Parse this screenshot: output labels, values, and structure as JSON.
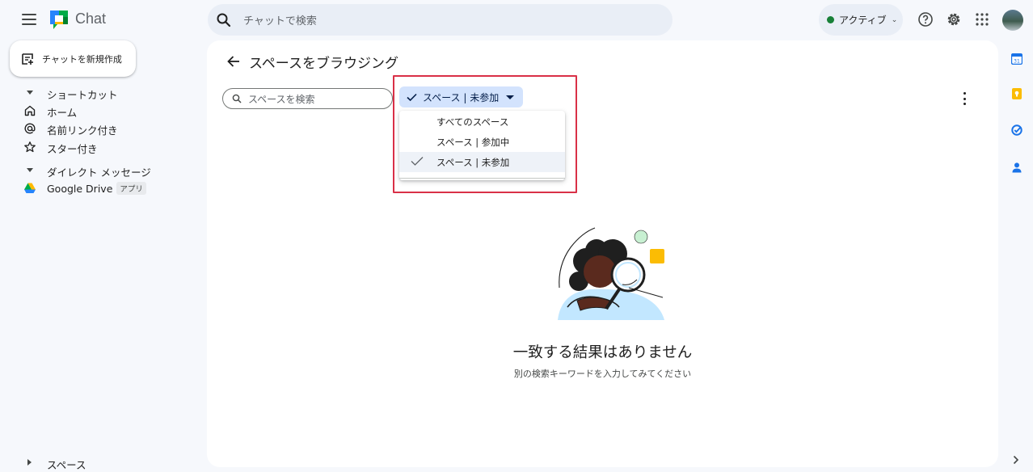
{
  "app": {
    "name": "Chat"
  },
  "header": {
    "search_placeholder": "チャットで検索",
    "status_label": "アクティブ",
    "status_color": "#188038"
  },
  "sidebar": {
    "new_chat_label": "チャットを新規作成",
    "shortcuts_label": "ショートカット",
    "items": [
      {
        "label": "ホーム",
        "icon": "home-icon"
      },
      {
        "label": "名前リンク付き",
        "icon": "at-icon"
      },
      {
        "label": "スター付き",
        "icon": "star-icon"
      }
    ],
    "dm_label": "ダイレクト メッセージ",
    "dm_items": [
      {
        "label": "Google Drive",
        "badge": "アプリ",
        "icon": "google-drive-icon"
      }
    ],
    "spaces_label": "スペース"
  },
  "main": {
    "title": "スペースをブラウジング",
    "search_placeholder": "スペースを検索",
    "filter_label": "スペース | 未参加",
    "dropdown_options": [
      {
        "label": "すべてのスペース",
        "selected": false
      },
      {
        "label": "スペース | 参加中",
        "selected": false
      },
      {
        "label": "スペース | 未参加",
        "selected": true
      }
    ],
    "empty_title": "一致する結果はありません",
    "empty_subtitle": "別の検索キーワードを入力してみてください"
  },
  "colors": {
    "accent": "#0b57d0",
    "chip_bg": "#d3e3fd",
    "highlight": "#d93047",
    "background": "#f6f8fc"
  }
}
